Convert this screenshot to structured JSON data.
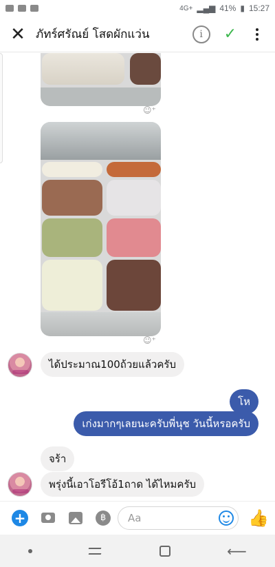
{
  "status_bar": {
    "network": "4G+",
    "battery": "41%",
    "time": "15:27"
  },
  "header": {
    "title": "ภัทร์ศรัณย์ โสดผักแว่น"
  },
  "messages": [
    {
      "id": "m1",
      "side": "in",
      "text": "ได้ประมาณ100ถ้วยแล้วครับ"
    },
    {
      "id": "m2",
      "side": "out",
      "text": "โห"
    },
    {
      "id": "m3",
      "side": "out",
      "text": "เก่งมากๆเลยนะครับพี่นุช วันนี้หรอครับ"
    },
    {
      "id": "m4",
      "side": "in",
      "text": "จร้า"
    },
    {
      "id": "m5",
      "side": "in",
      "text": "พรุ่งนี้เอาโอรีโอ้1ถาด ได้ไหมครับ"
    }
  ],
  "composer": {
    "placeholder": "Aa"
  },
  "colors": {
    "outgoing_bubble": "#3b5bab",
    "incoming_bubble": "#f1f0f0",
    "accent": "#1e88e5",
    "check": "#3db74e"
  },
  "icons": [
    "close-icon",
    "info-icon",
    "check-icon",
    "more-icon",
    "add-icon",
    "camera-icon",
    "image-icon",
    "baht-icon",
    "emoji-icon",
    "like-icon",
    "react-icon"
  ]
}
